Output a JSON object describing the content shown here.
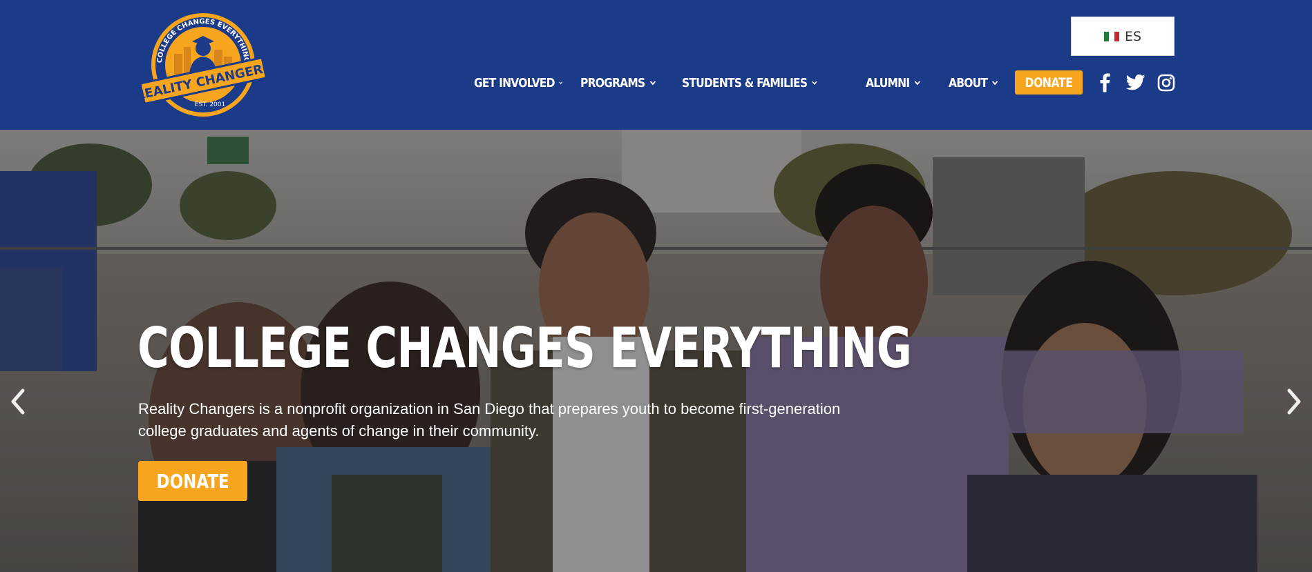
{
  "header": {
    "logo": {
      "arc_text": "COLLEGE CHANGES EVERYTHING",
      "banner_text": "REALITY CHANGERS",
      "est_text": "EST. 2001"
    },
    "language_button": {
      "label": "ES",
      "flag_icon": "mexico-flag-icon"
    },
    "nav": [
      {
        "label": "GET INVOLVED",
        "has_dropdown": true
      },
      {
        "label": "PROGRAMS",
        "has_dropdown": true
      },
      {
        "label": "STUDENTS & FAMILIES",
        "has_dropdown": true
      },
      {
        "label": "ALUMNI",
        "has_dropdown": true
      },
      {
        "label": "ABOUT",
        "has_dropdown": true
      }
    ],
    "donate_label": "DONATE",
    "socials": [
      "facebook-icon",
      "twitter-icon",
      "instagram-icon"
    ]
  },
  "hero": {
    "title": "COLLEGE CHANGES EVERYTHING",
    "description_line1": "Reality Changers is a nonprofit organization in San Diego that prepares youth to become first-generation",
    "description_line2": "college graduates and agents of change in their community.",
    "donate_label": "DONATE",
    "prev_icon": "chevron-left-icon",
    "next_icon": "chevron-right-icon"
  },
  "colors": {
    "header_bg": "#1b3a87",
    "accent": "#f7a51e",
    "text_light": "#ffffff"
  }
}
